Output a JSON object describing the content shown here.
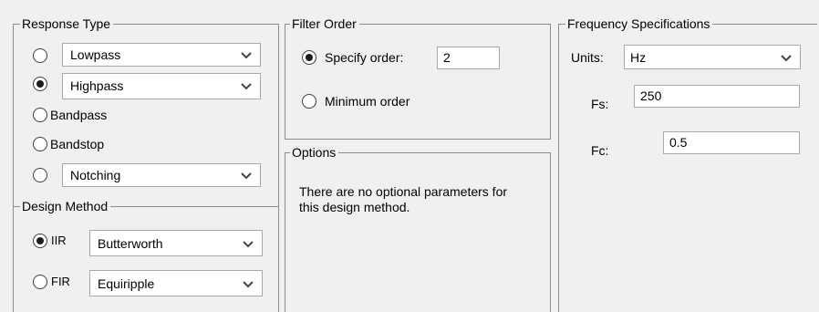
{
  "response_type": {
    "title": "Response Type",
    "options": [
      {
        "label": "Lowpass",
        "selected": false
      },
      {
        "label": "Highpass",
        "selected": true
      },
      {
        "label": "Bandpass",
        "selected": false
      },
      {
        "label": "Bandstop",
        "selected": false
      },
      {
        "label": "Notching",
        "selected": false
      }
    ]
  },
  "design_method": {
    "title": "Design Method",
    "iir": {
      "label": "IIR",
      "selected": true,
      "value": "Butterworth"
    },
    "fir": {
      "label": "FIR",
      "selected": false,
      "value": "Equiripple"
    }
  },
  "filter_order": {
    "title": "Filter Order",
    "specify_label": "Specify order:",
    "specify_selected": true,
    "order_value": "2",
    "minimum_label": "Minimum order",
    "minimum_selected": false
  },
  "options": {
    "title": "Options",
    "message": "There are no optional parameters for this design method."
  },
  "frequency_specifications": {
    "title": "Frequency Specifications",
    "units_label": "Units:",
    "units_value": "Hz",
    "fs_label": "Fs:",
    "fs_value": "250",
    "fc_label": "Fc:",
    "fc_value": "0.5"
  },
  "icons": {
    "dropdown": "chevron-down-icon"
  }
}
